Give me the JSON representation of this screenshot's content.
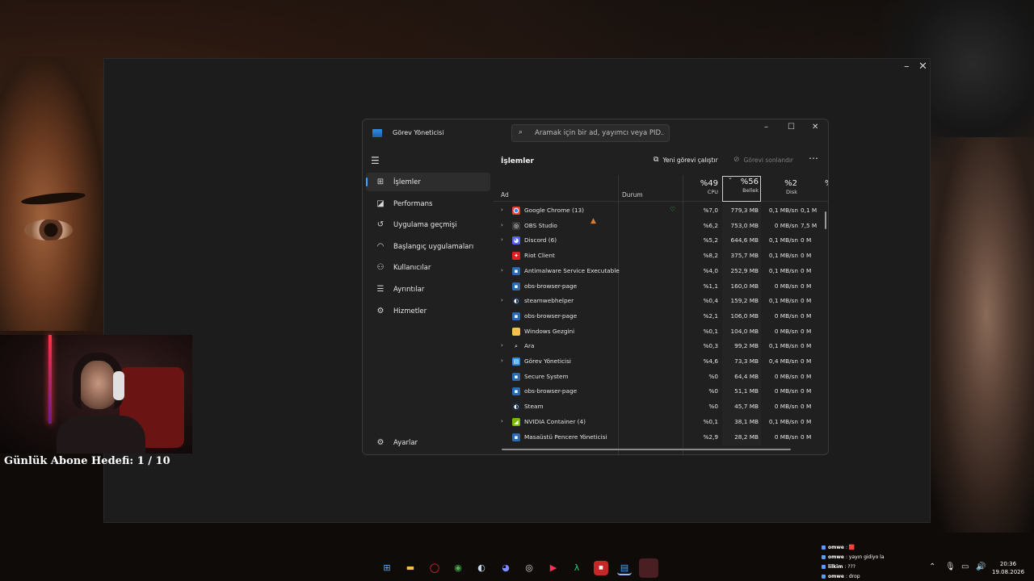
{
  "task_manager": {
    "title": "Görev Yöneticisi",
    "search_placeholder": "Aramak için bir ad, yayımcı veya PID...",
    "nav": [
      {
        "label": "İşlemler",
        "icon": "processes-icon",
        "active": true
      },
      {
        "label": "Performans",
        "icon": "performance-icon"
      },
      {
        "label": "Uygulama geçmişi",
        "icon": "app-history-icon"
      },
      {
        "label": "Başlangıç uygulamaları",
        "icon": "startup-icon"
      },
      {
        "label": "Kullanıcılar",
        "icon": "users-icon"
      },
      {
        "label": "Ayrıntılar",
        "icon": "details-icon"
      },
      {
        "label": "Hizmetler",
        "icon": "services-icon"
      }
    ],
    "settings_label": "Ayarlar",
    "heading": "İşlemler",
    "new_task_label": "Yeni görevi çalıştır",
    "end_task_label": "Görevi sonlandır",
    "columns": {
      "name": "Ad",
      "status": "Durum",
      "cpu_pct": "%49",
      "cpu_label": "CPU",
      "mem_pct": "%56",
      "mem_label": "Bellek",
      "disk_pct": "%2",
      "disk_label": "Disk",
      "net_pct": "%"
    },
    "processes": [
      {
        "name": "Google Chrome (13)",
        "expand": true,
        "icon": "chrome-icon",
        "status": "eco-icon",
        "cpu": "%7,0",
        "mem": "779,3 MB",
        "disk": "0,1 MB/sn",
        "net": "0,1 M"
      },
      {
        "name": "OBS Studio",
        "expand": true,
        "icon": "obs-icon",
        "cpu": "%6,2",
        "mem": "753,0 MB",
        "disk": "0 MB/sn",
        "net": "7,5 M"
      },
      {
        "name": "Discord (6)",
        "expand": true,
        "icon": "discord-icon",
        "cpu": "%5,2",
        "mem": "644,6 MB",
        "disk": "0,1 MB/sn",
        "net": "0 M"
      },
      {
        "name": "Riot Client",
        "expand": false,
        "icon": "riot-icon",
        "cpu": "%8,2",
        "mem": "375,7 MB",
        "disk": "0,1 MB/sn",
        "net": "0 M"
      },
      {
        "name": "Antimalware Service Executable",
        "expand": true,
        "icon": "app-icon",
        "cpu": "%4,0",
        "mem": "252,9 MB",
        "disk": "0,1 MB/sn",
        "net": "0 M"
      },
      {
        "name": "obs-browser-page",
        "expand": false,
        "icon": "app-icon",
        "cpu": "%1,1",
        "mem": "160,0 MB",
        "disk": "0 MB/sn",
        "net": "0 M"
      },
      {
        "name": "steamwebhelper",
        "expand": true,
        "icon": "steam-icon",
        "cpu": "%0,4",
        "mem": "159,2 MB",
        "disk": "0,1 MB/sn",
        "net": "0 M"
      },
      {
        "name": "obs-browser-page",
        "expand": false,
        "icon": "app-icon",
        "cpu": "%2,1",
        "mem": "106,0 MB",
        "disk": "0 MB/sn",
        "net": "0 M"
      },
      {
        "name": "Windows Gezgini",
        "expand": false,
        "icon": "folder-icon",
        "cpu": "%0,1",
        "mem": "104,0 MB",
        "disk": "0 MB/sn",
        "net": "0 M"
      },
      {
        "name": "Ara",
        "expand": true,
        "icon": "search-icon",
        "cpu": "%0,3",
        "mem": "99,2 MB",
        "disk": "0,1 MB/sn",
        "net": "0 M"
      },
      {
        "name": "Görev Yöneticisi",
        "expand": true,
        "icon": "taskmgr-icon",
        "cpu": "%4,6",
        "mem": "73,3 MB",
        "disk": "0,4 MB/sn",
        "net": "0 M"
      },
      {
        "name": "Secure System",
        "expand": false,
        "icon": "app-icon",
        "cpu": "%0",
        "mem": "64,4 MB",
        "disk": "0 MB/sn",
        "net": "0 M"
      },
      {
        "name": "obs-browser-page",
        "expand": false,
        "icon": "app-icon",
        "cpu": "%0",
        "mem": "51,1 MB",
        "disk": "0 MB/sn",
        "net": "0 M"
      },
      {
        "name": "Steam",
        "expand": false,
        "icon": "steam-icon",
        "cpu": "%0",
        "mem": "45,7 MB",
        "disk": "0 MB/sn",
        "net": "0 M"
      },
      {
        "name": "NVIDIA Container (4)",
        "expand": true,
        "icon": "nvidia-icon",
        "cpu": "%0,1",
        "mem": "38,1 MB",
        "disk": "0,1 MB/sn",
        "net": "0 M"
      },
      {
        "name": "Masaüstü Pencere Yöneticisi",
        "expand": false,
        "icon": "app-icon",
        "cpu": "%2,9",
        "mem": "28,2 MB",
        "disk": "0 MB/sn",
        "net": "0 M"
      }
    ]
  },
  "overlay": {
    "sub_goal": "Günlük Abone Hedefi: 1 / 10",
    "chat": [
      {
        "user": "omwe",
        "text": ": 🟥"
      },
      {
        "user": "omwe",
        "text": ": yayın gidiyo la"
      },
      {
        "user": "lilkim",
        "text": ": ???"
      },
      {
        "user": "omwe",
        "text": ": drop"
      }
    ]
  },
  "taskbar": {
    "apps": [
      "windows-start-icon",
      "file-explorer-icon",
      "opera-icon",
      "chrome-icon",
      "steam-icon",
      "discord-icon",
      "obs-icon",
      "youtube-icon",
      "app-green-icon",
      "app-red-icon",
      "taskmgr-icon",
      "app-dark-red-icon"
    ],
    "time": "20:36",
    "date": "19.08.2026"
  }
}
